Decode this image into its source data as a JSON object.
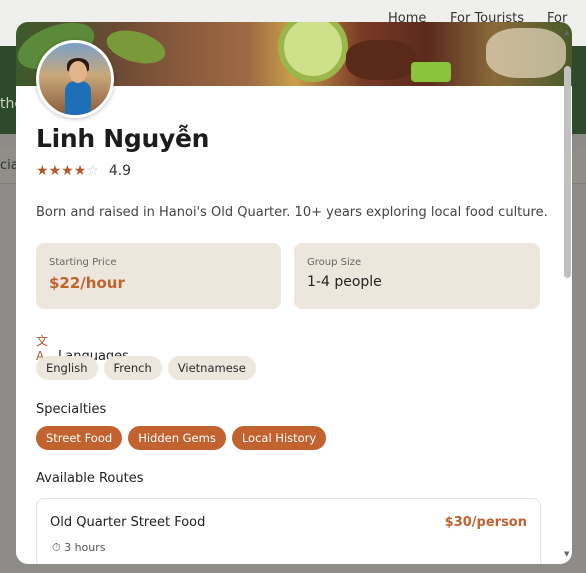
{
  "background": {
    "nav": [
      "Home",
      "For Tourists",
      "For Gu"
    ],
    "hero_fragment": "the",
    "strip_fragment": "ciali"
  },
  "guide": {
    "name": "Linh Nguyễn",
    "rating": 4.9,
    "rating_text": "4.9",
    "stars_filled": 4,
    "stars_total": 5,
    "bio": "Born and raised in Hanoi's Old Quarter. 10+ years exploring local food culture."
  },
  "stats": {
    "starting_price_label": "Starting Price",
    "starting_price_value": "$22/hour",
    "group_size_label": "Group Size",
    "group_size_value": "1-4 people"
  },
  "languages": {
    "title": "Languages",
    "icon": "translate-icon",
    "items": [
      "English",
      "French",
      "Vietnamese"
    ]
  },
  "specialties": {
    "title": "Specialties",
    "items": [
      "Street Food",
      "Hidden Gems",
      "Local History"
    ]
  },
  "routes": {
    "title": "Available Routes",
    "items": [
      {
        "name": "Old Quarter Street Food",
        "price": "$30/person",
        "duration": "3 hours",
        "duration_icon": "timer-icon"
      }
    ]
  },
  "colors": {
    "accent": "#c2622e",
    "chip_bg": "#ece6dc",
    "header_green": "#2e4a2c"
  }
}
